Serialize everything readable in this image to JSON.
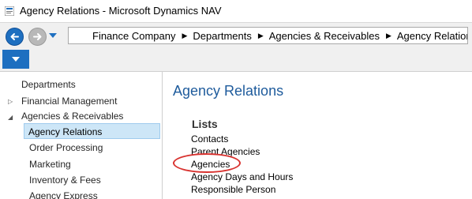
{
  "window": {
    "title": "Agency Relations - Microsoft Dynamics NAV"
  },
  "breadcrumb": [
    "Finance Company",
    "Departments",
    "Agencies & Receivables",
    "Agency Relations"
  ],
  "navpane": {
    "items": [
      {
        "label": "Departments",
        "expander": ""
      },
      {
        "label": "Financial Management",
        "expander": "collapsed"
      },
      {
        "label": "Agencies & Receivables",
        "expander": "expanded"
      },
      {
        "label": "Agency Relations",
        "selected": true
      },
      {
        "label": "Order Processing"
      },
      {
        "label": "Marketing"
      },
      {
        "label": "Inventory & Fees"
      },
      {
        "label": "Agency Express"
      }
    ]
  },
  "content": {
    "title": "Agency Relations",
    "section": "Lists",
    "links": [
      "Contacts",
      "Parent Agencies",
      "Agencies",
      "Agency Days and Hours",
      "Responsible Person"
    ],
    "highlighted_link": "Agencies"
  },
  "colors": {
    "accent": "#1e6fc0",
    "title": "#1e5b9c",
    "selection": "#cde6f7",
    "highlight_circle": "#d8322f"
  },
  "icons": [
    "app-icon",
    "back-arrow-icon",
    "forward-arrow-icon",
    "history-dropdown-icon",
    "ribbon-menu-icon",
    "breadcrumb-separator-icon",
    "tree-expander-icon"
  ]
}
